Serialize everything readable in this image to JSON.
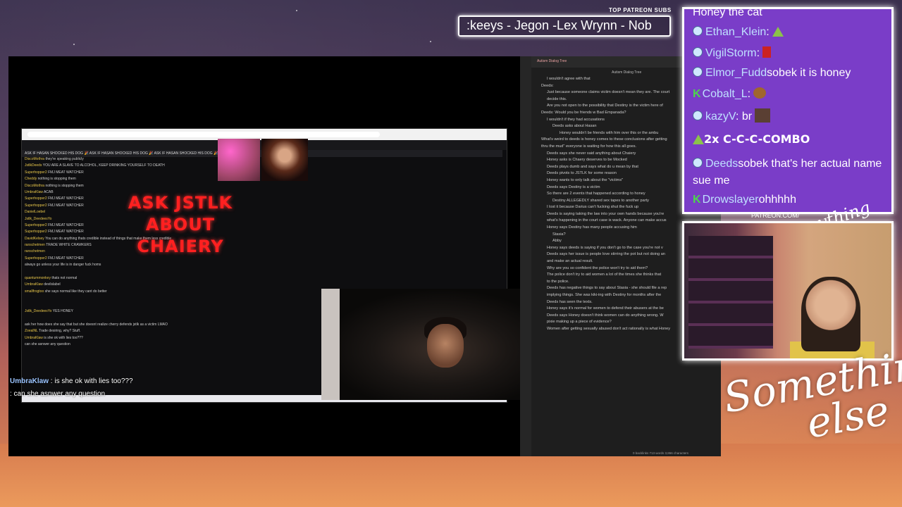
{
  "top_subs": {
    "label": "TOP PATREON SUBS",
    "text": ":keeys - Jegon -Lex Wrynn -  Nob"
  },
  "stream_chat_overlay": [
    {
      "user": "UmbraKlaw",
      "text": ": is she ok with lies too???"
    },
    {
      "user": "",
      "text": ": can she asnwer any question"
    }
  ],
  "browser_chat": {
    "banner": "ASK IF HASAN SHOCKED HIS DOG 🎉 ASK IF HASAN SHOCKED HIS DOG 🎉 ASK IF HASAN SHOCKED HIS DOG 🎉",
    "lines": [
      {
        "name": "DiscoMothra",
        "text": "they're speaking publicly"
      },
      {
        "name": "JstlkDeeds",
        "text": "YOU ARE A SLAVE TO ALCOHOL, KEEP DRINKING YOURSELF TO DEATH"
      },
      {
        "name": "Superhopper2",
        "text": "FMJ MEAT WATCHER"
      },
      {
        "name": "Cheddy",
        "text": "nothing is stopping them"
      },
      {
        "name": "DiscoMothra",
        "text": "nothing is stopping them"
      },
      {
        "name": "UmbraKlaw",
        "text": "ACAB"
      },
      {
        "name": "Superhopper2",
        "text": "FMJ MEAT WATCHER"
      },
      {
        "name": "Superhopper2",
        "text": "FMJ MEAT WATCHER"
      },
      {
        "name": "DanielLoebel",
        "text": ""
      },
      {
        "name": "Jstlk_DeedeesYo",
        "text": ""
      },
      {
        "name": "Superhopper2",
        "text": "FMJ MEAT WATCHER"
      },
      {
        "name": "Superhopper2",
        "text": "FMJ MEAT WATCHER"
      },
      {
        "name": "DavidKelsey",
        "text": "You can do anything thats credible instead of things that make them less credible"
      },
      {
        "name": "ranschetmen",
        "text": "TRADE WHITE CRAWKERS"
      },
      {
        "name": "ranschetmen",
        "text": ""
      },
      {
        "name": "Superhopper2",
        "text": "FMJ MEAT WATCHER"
      },
      {
        "name": "",
        "text": "always go unless your life is in danger fuck homs"
      },
      {
        "name": "",
        "text": ""
      },
      {
        "name": "quantummonkey",
        "text": "thats not normal"
      },
      {
        "name": "UmbraKlaw",
        "text": "devilslabel"
      },
      {
        "name": "smallfrogtoo",
        "text": "she says normal like they cant do better"
      },
      {
        "name": "",
        "text": ""
      },
      {
        "name": "",
        "text": ""
      },
      {
        "name": "Jstlk_DeedeesYo",
        "text": "YES HONEY"
      },
      {
        "name": "",
        "text": ""
      },
      {
        "name": "",
        "text": "ask her how does she say that but she doesnt realize cherry defends jstlk as a victim LMAO"
      },
      {
        "name": "ZoealNL",
        "text": "Trade desiring, why? Stuff."
      },
      {
        "name": "UmbraKlaw",
        "text": "is she ok with lies too???"
      },
      {
        "name": "",
        "text": "can she asnwer any question"
      }
    ]
  },
  "ask_sign": {
    "text": "ASK JSTLK ABOUT CHAIERY"
  },
  "notes": {
    "tab_label": "Autism Dialog Tree",
    "title": "Autism Dialog Tree",
    "status": "0 backlinks   713 words   3,866 characters",
    "lines": [
      {
        "indent": 1,
        "text": "I wouldn't agree with that"
      },
      {
        "indent": 0,
        "text": "Deeds:"
      },
      {
        "indent": 1,
        "text": "Just because someone claims victim doesn't mean they are. The court"
      },
      {
        "indent": 1,
        "text": "decide this."
      },
      {
        "indent": 1,
        "text": "Are you not open to the possibility that Destiny is the victim here of"
      },
      {
        "indent": 0,
        "text": ""
      },
      {
        "indent": 0,
        "text": "Deeds: Would you be friends w Bad Empanada?"
      },
      {
        "indent": 1,
        "text": "I wouldn't if they had accusations"
      },
      {
        "indent": 2,
        "text": "Deeds asks about Hasan"
      },
      {
        "indent": 3,
        "text": "Honey wouldn't be friends with him over this or the ambu"
      },
      {
        "indent": 0,
        "text": ""
      },
      {
        "indent": 0,
        "text": "What's weird to deeds is honey comes to these conclusions after getting"
      },
      {
        "indent": 0,
        "text": "thru the mud\" everyone is waiting for how this all goes."
      },
      {
        "indent": 1,
        "text": "Deeds says she never said anything about Chaiery"
      },
      {
        "indent": 1,
        "text": "Honey asks is Chaery deserves to be Mocked"
      },
      {
        "indent": 1,
        "text": "Deeds plays dumb and says what do u mean by that"
      },
      {
        "indent": 1,
        "text": "Deeds pivots to JSTLK for some reason"
      },
      {
        "indent": 1,
        "text": "Honey wants to only talk about the \"victims\""
      },
      {
        "indent": 1,
        "text": "Deeds says Destiny is a victim"
      },
      {
        "indent": 1,
        "text": "So there are 2 events that happened according to honey"
      },
      {
        "indent": 2,
        "text": "Destiny ALLEGEDLY shared sex tapes to another party"
      },
      {
        "indent": 1,
        "text": "I lost it because Darius can't fucking shut the fuck up"
      },
      {
        "indent": 1,
        "text": "Deeds is saying taking the law into your own hands because you're"
      },
      {
        "indent": 1,
        "text": "what's happening in the court case is wack. Anyone can make accus"
      },
      {
        "indent": 1,
        "text": "Honey says Destiny has many people accusing him"
      },
      {
        "indent": 2,
        "text": "Stasia?"
      },
      {
        "indent": 2,
        "text": "Abby"
      },
      {
        "indent": 1,
        "text": "Honey says deeds is saying if you don't go to the case you're  not v"
      },
      {
        "indent": 1,
        "text": "Deeds says her issue is people love stirring the pot but not doing an"
      },
      {
        "indent": 1,
        "text": "and make an actual result."
      },
      {
        "indent": 1,
        "text": "Why are you so confident the police won't try to aid them?"
      },
      {
        "indent": 1,
        "text": "The police don't try to aid women a lot of the times she thinks that"
      },
      {
        "indent": 1,
        "text": "to the police."
      },
      {
        "indent": 1,
        "text": "Deeds has negative things to say about Stasia - she should file a rep"
      },
      {
        "indent": 1,
        "text": "implying things. She was kiki-ing with Destiny for months after the"
      },
      {
        "indent": 1,
        "text": "Deeds has seen the texts."
      },
      {
        "indent": 1,
        "text": "Honey says it's normal for women to defend their abusers at the be"
      },
      {
        "indent": 1,
        "text": "Deeds says Honey doesn't think women can do anything wrong. W"
      },
      {
        "indent": 1,
        "text": "pixie making up a piece of evidence?"
      },
      {
        "indent": 1,
        "text": "Women after getting sexually abused don't act rationally is what Honey"
      }
    ]
  },
  "right_chat": {
    "top_partial": "Honey the cat",
    "lines": [
      {
        "user": "Ethan_Klein",
        "text": ":",
        "badge": "ring",
        "emote": "pyramid"
      },
      {
        "user": "VigilStorm",
        "text": ":",
        "badge": "ring",
        "emote": "figure"
      },
      {
        "user": "Elmor_Fudd",
        "text": "sobek it is honey",
        "badge": "ring",
        "emote": ""
      },
      {
        "user": "Cobalt_L",
        "text": ":",
        "badge": "k",
        "emote": "bear"
      },
      {
        "user": "kazyV",
        "text": ": br",
        "badge": "ring",
        "emote": "pic"
      },
      {
        "user": "",
        "text": "2x C-C-C-COMBO",
        "badge": "pyramid",
        "emote": ""
      },
      {
        "user": "Deeds",
        "text": "sobek that's her actual name sue me",
        "badge": "ring",
        "emote": ""
      },
      {
        "user": "Drowslayer",
        "text": "ohhhhh",
        "badge": "k",
        "emote": ""
      }
    ]
  },
  "patreon_url": "PATREON.COM/",
  "signature_small": "Anything else",
  "brand": {
    "line1": "Something",
    "line2": "else"
  }
}
